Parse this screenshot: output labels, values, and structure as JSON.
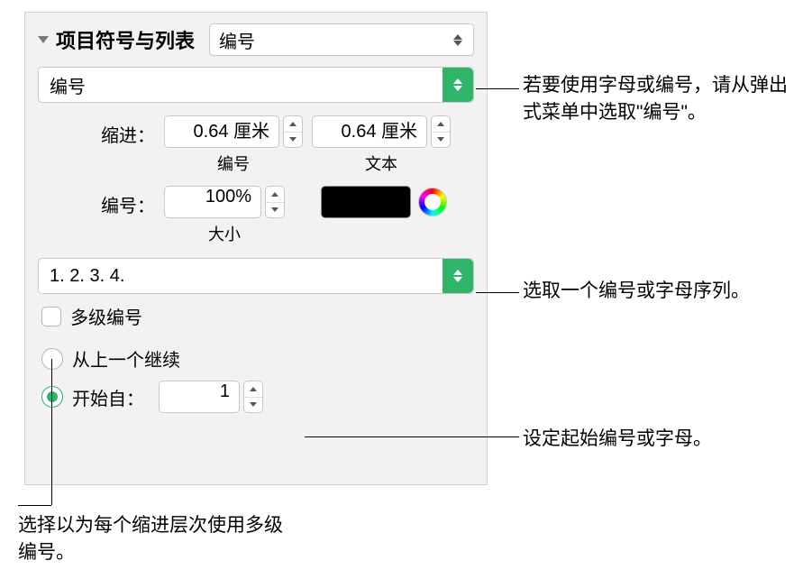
{
  "header": {
    "title": "项目符号与列表",
    "style_select": "编号"
  },
  "type_select": "编号",
  "indent": {
    "label": "缩进：",
    "number_value": "0.64 厘米",
    "number_sublabel": "编号",
    "text_value": "0.64 厘米",
    "text_sublabel": "文本"
  },
  "size": {
    "label": "编号：",
    "value": "100%",
    "sublabel": "大小"
  },
  "sequence_select": "1. 2. 3. 4.",
  "tiered": {
    "label": "多级编号"
  },
  "continue": {
    "label": "从上一个继续"
  },
  "start": {
    "label": "开始自：",
    "value": "1"
  },
  "callouts": {
    "c1": "若要使用字母或编号，请从弹出式菜单中选取\"编号\"。",
    "c2": "选取一个编号或字母序列。",
    "c3": "设定起始编号或字母。",
    "c4": "选择以为每个缩进层次使用多级编号。"
  }
}
